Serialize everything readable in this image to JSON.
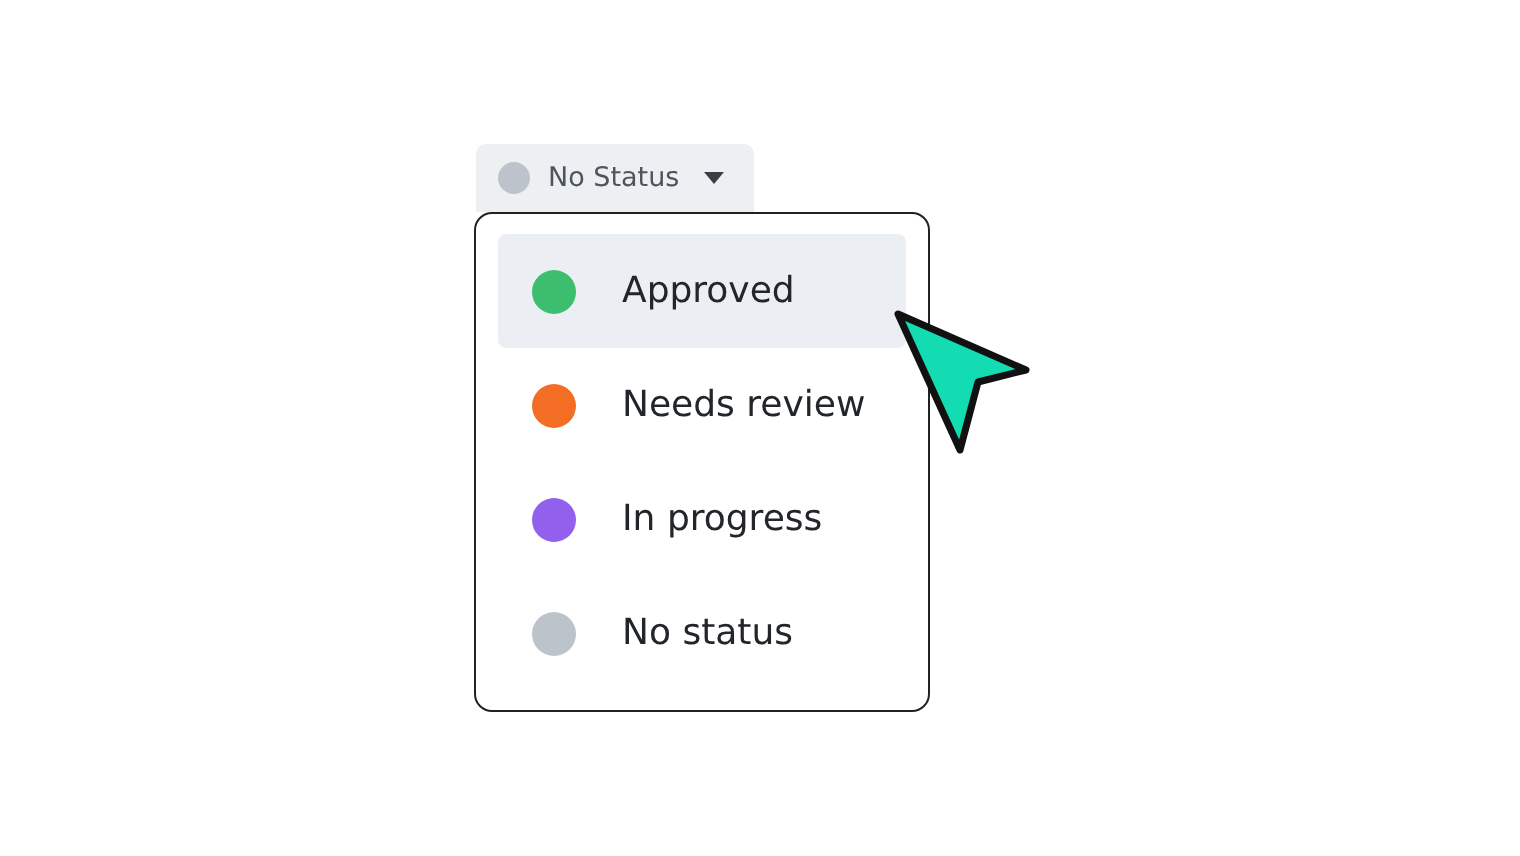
{
  "dropdown": {
    "label": "No Status",
    "color": "#bcc3ca",
    "expanded": true
  },
  "options": [
    {
      "label": "Approved",
      "color": "#3dbe6e",
      "selected": true
    },
    {
      "label": "Needs review",
      "color": "#f46d25",
      "selected": false
    },
    {
      "label": "In progress",
      "color": "#9360ee",
      "selected": false
    },
    {
      "label": "No status",
      "color": "#bcc3ca",
      "selected": false
    }
  ]
}
